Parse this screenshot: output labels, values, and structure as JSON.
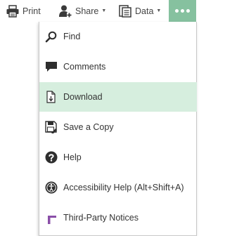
{
  "toolbar": {
    "print": {
      "label": "Print",
      "icon": "printer-icon"
    },
    "share": {
      "label": "Share",
      "icon": "share-user-icon"
    },
    "data": {
      "label": "Data",
      "icon": "data-icon"
    },
    "more": {
      "icon": "more-dots-icon"
    },
    "accent_color": "#86c19f"
  },
  "menu": {
    "highlight_color": "#d6eede",
    "items": [
      {
        "label": "Find",
        "icon": "search-icon"
      },
      {
        "label": "Comments",
        "icon": "comment-icon"
      },
      {
        "label": "Download",
        "icon": "download-icon",
        "active": true
      },
      {
        "label": "Save a Copy",
        "icon": "save-copy-icon"
      },
      {
        "label": "Help",
        "icon": "help-icon"
      },
      {
        "label": "Accessibility Help (Alt+Shift+A)",
        "icon": "accessibility-icon"
      },
      {
        "label": "Third-Party Notices",
        "icon": "notices-icon"
      }
    ]
  }
}
